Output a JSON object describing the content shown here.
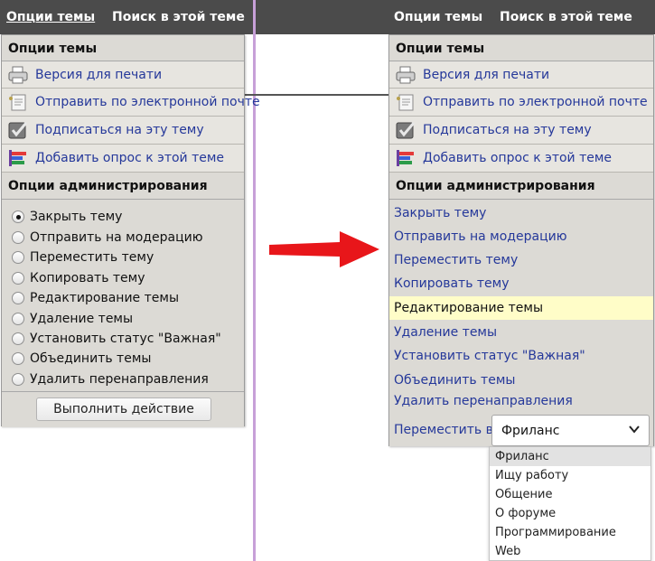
{
  "nav": {
    "left_options": "Опции темы",
    "left_search": "Поиск в этой теме",
    "right_options": "Опции темы",
    "right_search": "Поиск в этой теме"
  },
  "left_panel": {
    "header": "Опции темы",
    "items": [
      {
        "label": "Версия для печати",
        "icon": "printer-icon"
      },
      {
        "label": "Отправить по электронной почте",
        "icon": "email-icon"
      },
      {
        "label": "Подписаться на эту тему",
        "icon": "subscribe-icon"
      },
      {
        "label": "Добавить опрос к этой теме",
        "icon": "poll-icon"
      }
    ],
    "admin_header": "Опции администрирования",
    "radios": [
      {
        "label": "Закрыть тему",
        "checked": true
      },
      {
        "label": "Отправить на модерацию",
        "checked": false
      },
      {
        "label": "Переместить тему",
        "checked": false
      },
      {
        "label": "Копировать тему",
        "checked": false
      },
      {
        "label": "Редактирование темы",
        "checked": false
      },
      {
        "label": "Удаление темы",
        "checked": false
      },
      {
        "label": "Установить статус \"Важная\"",
        "checked": false
      },
      {
        "label": "Объединить темы",
        "checked": false
      },
      {
        "label": "Удалить перенаправления",
        "checked": false
      }
    ],
    "submit_button": "Выполнить действие"
  },
  "right_panel": {
    "header": "Опции темы",
    "items": [
      {
        "label": "Версия для печати",
        "icon": "printer-icon"
      },
      {
        "label": "Отправить по электронной почте",
        "icon": "email-icon"
      },
      {
        "label": "Подписаться на эту тему",
        "icon": "subscribe-icon"
      },
      {
        "label": "Добавить опрос к этой теме",
        "icon": "poll-icon"
      }
    ],
    "admin_header": "Опции администрирования",
    "links": [
      {
        "label": "Закрыть тему",
        "highlighted": false
      },
      {
        "label": "Отправить на модерацию",
        "highlighted": false
      },
      {
        "label": "Переместить тему",
        "highlighted": false
      },
      {
        "label": "Копировать тему",
        "highlighted": false
      },
      {
        "label": "Редактирование темы",
        "highlighted": true
      },
      {
        "label": "Удаление темы",
        "highlighted": false
      },
      {
        "label": "Установить статус \"Важная\"",
        "highlighted": false
      },
      {
        "label": "Объединить темы",
        "highlighted": false
      },
      {
        "label": "Удалить перенаправления",
        "highlighted": false
      }
    ],
    "move_to_label": "Переместить в",
    "move_to_selected": "Фриланс",
    "move_to_options": [
      "Фриланс",
      "Ищу работу",
      "Общение",
      "О форуме",
      "Программирование",
      "Web"
    ]
  },
  "colors": {
    "topbar": "#4b4b4b",
    "link": "#25389a",
    "highlight": "#fffdc8",
    "arrow": "#e8161a"
  }
}
